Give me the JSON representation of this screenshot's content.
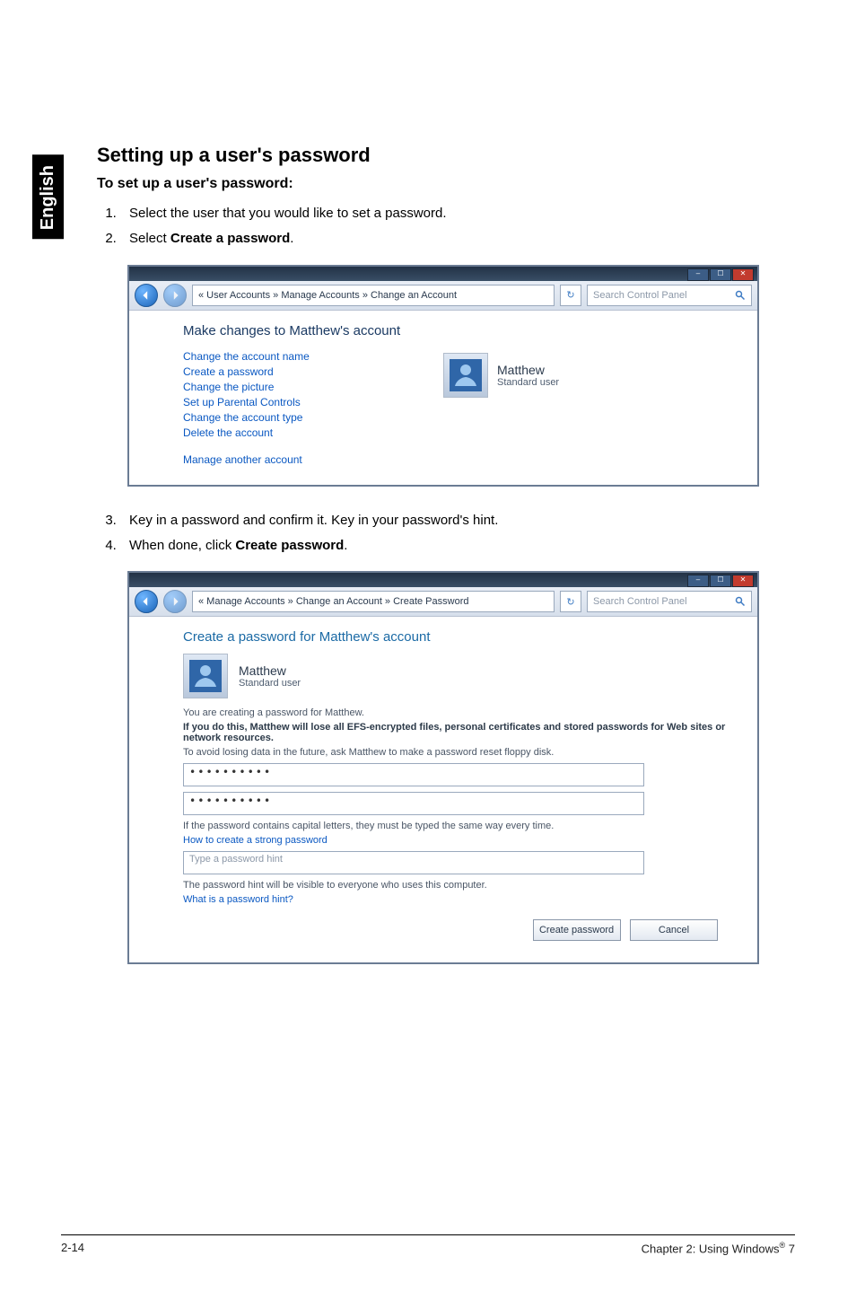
{
  "side_tab": "English",
  "heading": "Setting up a user's password",
  "subheading": "To set up a user's password:",
  "steps_a": [
    "Select the user that you would like to set a password.",
    [
      "Select ",
      "Create a password",
      "."
    ]
  ],
  "steps_b": [
    "Key in a password and confirm it. Key in your password's hint.",
    [
      "When done, click ",
      "Create password",
      "."
    ]
  ],
  "win1": {
    "breadcrumb": "« User Accounts » Manage Accounts » Change an Account",
    "search_placeholder": "Search Control Panel",
    "title": "Make changes to Matthew's account",
    "links": [
      "Change the account name",
      "Create a password",
      "Change the picture",
      "Set up Parental Controls",
      "Change the account type",
      "Delete the account",
      "Manage another account"
    ],
    "user_name": "Matthew",
    "user_type": "Standard user"
  },
  "win2": {
    "breadcrumb": "« Manage Accounts » Change an Account » Create Password",
    "search_placeholder": "Search Control Panel",
    "title": "Create a password for Matthew's account",
    "user_name": "Matthew",
    "user_type": "Standard user",
    "note_creating": "You are creating a password for Matthew.",
    "note_warn": "If you do this, Matthew will lose all EFS-encrypted files, personal certificates and stored passwords for Web sites or network resources.",
    "note_avoid": "To avoid losing data in the future, ask Matthew to make a password reset floppy disk.",
    "pw1": "••••••••••",
    "pw2": "••••••••••",
    "note_caps": "If the password contains capital letters, they must be typed the same way every time.",
    "link_strong": "How to create a strong password",
    "hint_placeholder": "Type a password hint",
    "note_hint": "The password hint will be visible to everyone who uses this computer.",
    "link_hint": "What is a password hint?",
    "btn_create": "Create password",
    "btn_cancel": "Cancel"
  },
  "footer": {
    "left": "2-14",
    "right_a": "Chapter 2: Using Windows",
    "right_b": " 7"
  }
}
